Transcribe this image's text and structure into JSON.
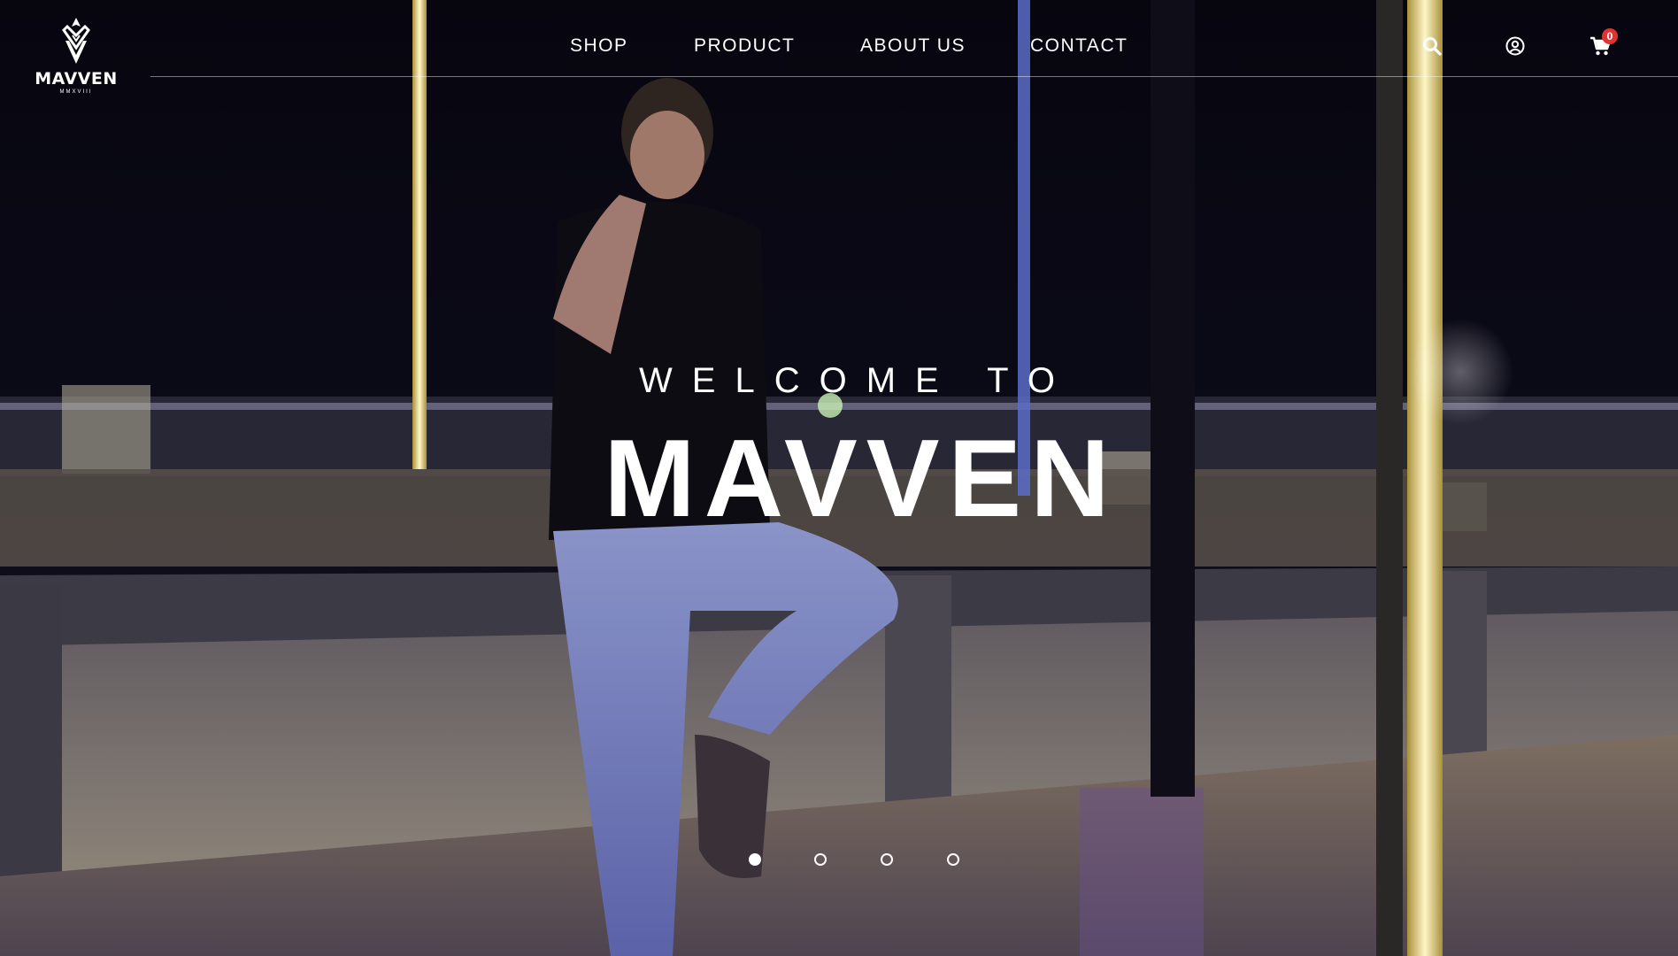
{
  "header": {
    "logo": {
      "wordmark": "MAVVEN",
      "tagline": "MMXVIII"
    },
    "nav": [
      {
        "label": "SHOP"
      },
      {
        "label": "PRODUCT"
      },
      {
        "label": "ABOUT US"
      },
      {
        "label": "CONTACT"
      }
    ],
    "icons": {
      "search": "search-icon",
      "account": "account-icon",
      "cart": "cart-icon"
    },
    "cart_count": "0"
  },
  "hero": {
    "welcome_text": "WELCOME TO",
    "brand_text": "MAVVEN",
    "slider": {
      "total_slides": 4,
      "active_slide": 1
    }
  },
  "colors": {
    "text": "#ffffff",
    "badge": "#e03232"
  }
}
